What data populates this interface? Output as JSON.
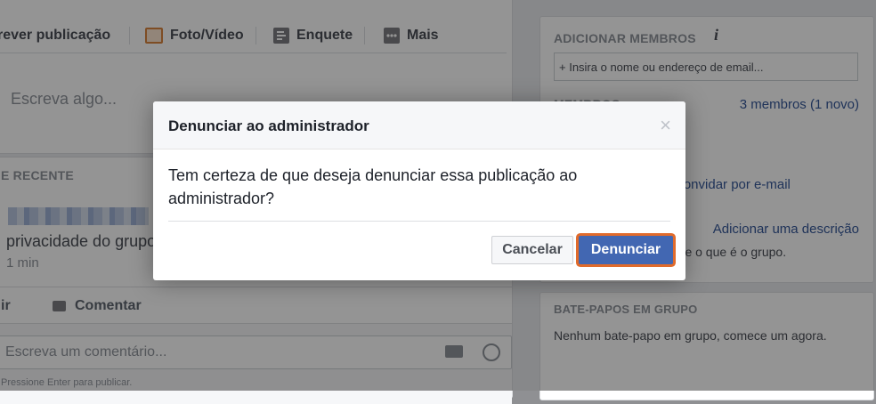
{
  "composer": {
    "tabs": [
      {
        "label": "rever publicação",
        "icon": "pencil-icon"
      },
      {
        "label": "Foto/Vídeo",
        "icon": "photo-icon"
      },
      {
        "label": "Enquete",
        "icon": "poll-icon"
      },
      {
        "label": "Mais",
        "icon": "more-icon"
      }
    ],
    "placeholder": "Escreva algo..."
  },
  "feed": {
    "section_label": "E RECENTE",
    "post": {
      "text_partial": "privacidade do grupo",
      "time": "1 min"
    },
    "actions": {
      "like_partial": "ir",
      "comment": "Comentar"
    },
    "comment_placeholder": "Escreva um comentário...",
    "enter_hint": "Pressione Enter para publicar."
  },
  "sidebar": {
    "add_members_title": "ADICIONAR MEMBROS",
    "add_members_placeholder": "+ Insira o nome ou endereço de email...",
    "members_label": "MEMBROS",
    "members_count": "3 membros (1 novo)",
    "invite_email": "Convidar por e-mail",
    "add_description": "Adicionar uma descrição",
    "description_hint": "ore o que é o grupo.",
    "group_chats_title": "BATE-PAPOS EM GRUPO",
    "group_chats_text": "Nenhum bate-papo em grupo, comece um agora."
  },
  "modal": {
    "title": "Denunciar ao administrador",
    "close": "×",
    "body": "Tem certeza de que deseja denunciar essa publicação ao administrador?",
    "cancel_label": "Cancelar",
    "confirm_label": "Denunciar"
  },
  "colors": {
    "primary_blue": "#4267b2",
    "highlight_orange": "#e16b2b",
    "link": "#365899"
  }
}
